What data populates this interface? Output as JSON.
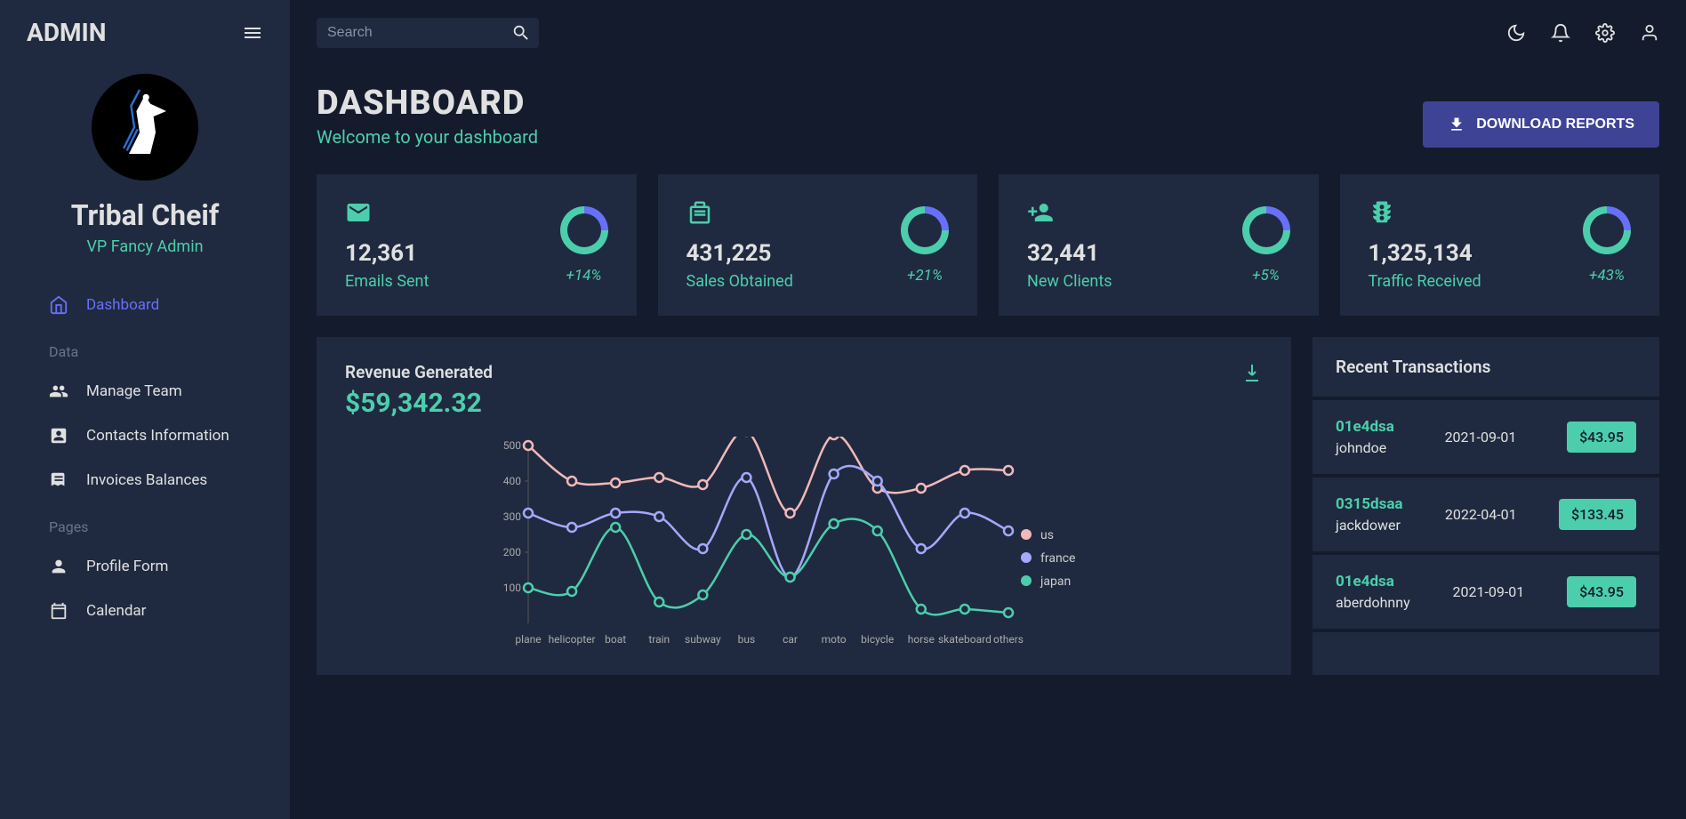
{
  "sidebar": {
    "brand": "ADMIN",
    "profile": {
      "name": "Tribal Cheif",
      "role": "VP Fancy Admin"
    },
    "nav": {
      "dashboard": "Dashboard",
      "group_data": "Data",
      "manage_team": "Manage Team",
      "contacts": "Contacts Information",
      "invoices": "Invoices Balances",
      "group_pages": "Pages",
      "profile_form": "Profile Form",
      "calendar": "Calendar"
    }
  },
  "topbar": {
    "search_placeholder": "Search"
  },
  "header": {
    "title": "DASHBOARD",
    "subtitle": "Welcome to your dashboard",
    "download_button": "DOWNLOAD REPORTS"
  },
  "stats": [
    {
      "icon": "email",
      "value": "12,361",
      "label": "Emails Sent",
      "change": "+14%"
    },
    {
      "icon": "pos",
      "value": "431,225",
      "label": "Sales Obtained",
      "change": "+21%"
    },
    {
      "icon": "person_add",
      "value": "32,441",
      "label": "New Clients",
      "change": "+5%"
    },
    {
      "icon": "traffic",
      "value": "1,325,134",
      "label": "Traffic Received",
      "change": "+43%"
    }
  ],
  "revenue": {
    "title": "Revenue Generated",
    "amount": "$59,342.32"
  },
  "chart_data": {
    "type": "line",
    "categories": [
      "plane",
      "helicopter",
      "boat",
      "train",
      "subway",
      "bus",
      "car",
      "moto",
      "bicycle",
      "horse",
      "skateboard",
      "others"
    ],
    "series": [
      {
        "name": "us",
        "color": "#f1b9b7",
        "values": [
          500,
          400,
          395,
          410,
          390,
          540,
          310,
          530,
          380,
          380,
          430,
          430
        ]
      },
      {
        "name": "france",
        "color": "#a4a9fc",
        "values": [
          310,
          270,
          310,
          300,
          210,
          410,
          130,
          420,
          400,
          210,
          310,
          260
        ]
      },
      {
        "name": "japan",
        "color": "#4cceac",
        "values": [
          100,
          90,
          270,
          60,
          80,
          250,
          130,
          280,
          260,
          40,
          40,
          30
        ]
      }
    ],
    "ylim": [
      0,
      500
    ],
    "yticks": [
      100,
      200,
      300,
      400,
      500
    ]
  },
  "transactions": {
    "title": "Recent Transactions",
    "items": [
      {
        "id": "01e4dsa",
        "user": "johndoe",
        "date": "2021-09-01",
        "cost": "$43.95"
      },
      {
        "id": "0315dsaa",
        "user": "jackdower",
        "date": "2022-04-01",
        "cost": "$133.45"
      },
      {
        "id": "01e4dsa",
        "user": "aberdohnny",
        "date": "2021-09-01",
        "cost": "$43.95"
      }
    ]
  }
}
